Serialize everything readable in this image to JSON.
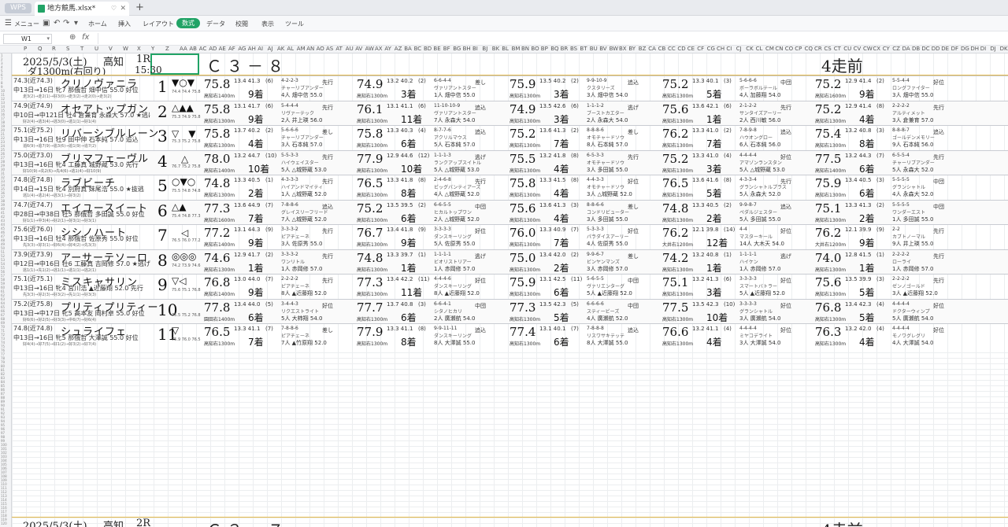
{
  "app": {
    "badge": "WPS",
    "file_tab": "地方競馬.xlsx*",
    "accent": "#21a366"
  },
  "menu": {
    "menu_label": "メニュー",
    "tabs": [
      "ホーム",
      "挿入",
      "レイアウト",
      "数式",
      "データ",
      "校閲",
      "表示",
      "ツール"
    ],
    "active_tab": "数式"
  },
  "formula": {
    "cell_ref": "W1",
    "fx": "fx",
    "content": ""
  },
  "columns": [
    "P",
    "Q",
    "R",
    "S",
    "T",
    "U",
    "V",
    "W",
    "X",
    "Y",
    "Z",
    "AA",
    "AB",
    "AC",
    "AD",
    "AE",
    "AF",
    "AG",
    "AH",
    "AI",
    "AJ",
    "AK",
    "AL",
    "AM",
    "AN",
    "AO",
    "AS",
    "AT",
    "AU",
    "AV",
    "AW",
    "AX",
    "AY",
    "AZ",
    "BA",
    "BC",
    "BD",
    "BE",
    "BF",
    "BG",
    "BH",
    "BI",
    "BJ",
    "BK",
    "BL",
    "BM",
    "BN",
    "BO",
    "BP",
    "BQ",
    "BR",
    "BS",
    "BT",
    "BU",
    "BV",
    "BW",
    "BX",
    "BY",
    "BZ",
    "CA",
    "CB",
    "CC",
    "CD",
    "CE",
    "CF",
    "CG",
    "CH",
    "CI",
    "CJ",
    "CK",
    "CL",
    "CM",
    "CN",
    "CO",
    "CP",
    "CQ",
    "CR",
    "CS",
    "CT",
    "CU",
    "CV",
    "CW",
    "CX",
    "CY",
    "CZ",
    "DA",
    "DB",
    "DC",
    "DD",
    "DE",
    "DF",
    "DG",
    "DH",
    "DI",
    "DJ",
    "DK",
    "DL",
    "DM",
    "DN"
  ],
  "race": {
    "date": "2025/5/3(土)",
    "venue": "高知",
    "race_no": "1R",
    "course": "ダ1300m(右回り)",
    "time": "15:30",
    "class": "Ｃ３－８",
    "prev_label": "4走前"
  },
  "horses": [
    {
      "rating": "74.3(近74.3)",
      "name": "クリノヴァニラ",
      "info": "中13日→16日 牝7 那俄哲 畑中信 55.0 好位",
      "trend": "走3(2)→走2(1)→好3(0)→走3(2)→走2(0)→走3(2)",
      "num": "1",
      "marks": "▼○▼",
      "idx": "74.4 74.4 75.8",
      "recs": [
        {
          "score": "75.8",
          "small": "13.4 41.3",
          "pos": "(6)",
          "course": "高知右1400m",
          "finish": "9着",
          "pass": "4-2-2-3",
          "horse": "チャーリブアンダー",
          "jockey": "4人 畑中信 55.0",
          "style": "先行"
        },
        {
          "score": "74.9",
          "small": "13.2 40.2",
          "pos": "(2)",
          "course": "高知右1300m",
          "finish": "3着",
          "pass": "6-6-4-4",
          "horse": "ヴァリアントスター",
          "jockey": "1人 畑中信 55.0",
          "style": "差し"
        },
        {
          "score": "75.9",
          "small": "13.5 40.2",
          "pos": "(2)",
          "course": "高知右1300m",
          "finish": "3着",
          "pass": "9-9-10-9",
          "horse": "クスタリーズ",
          "jockey": "3人 畑中信 54.0",
          "style": "追込"
        },
        {
          "score": "75.2",
          "small": "13.3 40.1",
          "pos": "(3)",
          "course": "高知右1300m",
          "finish": "5着",
          "pass": "5-6-6-6",
          "horse": "ボーラボルテール",
          "jockey": "4人 加藤翔 54.0",
          "style": "中団"
        },
        {
          "score": "75.2",
          "small": "12.9 41.4",
          "pos": "(2)",
          "course": "高知右1600m",
          "finish": "9着",
          "pass": "5-5-4-4",
          "horse": "ロングファイター",
          "jockey": "3人 畑中信 55.0",
          "style": "好位"
        }
      ]
    },
    {
      "rating": "74.9(近74.9)",
      "name": "オセアトップガン",
      "info": "中10日→中121日 牡4 倉兼育 永森大 57.0 ★逃げ",
      "trend": "好2(4)→逃3(4)→逃3(0)→逃1(1)→好1(4)",
      "num": "2",
      "marks": "△▲▲",
      "idx": "75.3 74.9 75.8",
      "recs": [
        {
          "score": "75.8",
          "small": "13.1 41.7",
          "pos": "(6)",
          "course": "高知右1300m",
          "finish": "9着",
          "pass": "5-4-4-4",
          "horse": "リヴァーテック",
          "jockey": "2人 井上瑛 56.0",
          "style": "先行"
        },
        {
          "score": "76.1",
          "small": "13.1 41.1",
          "pos": "(6)",
          "course": "高知右1300m",
          "finish": "11着",
          "pass": "11-10-10-9",
          "horse": "ヴァリアントスター",
          "jockey": "7人 永森大 54.0",
          "style": "追込"
        },
        {
          "score": "74.9",
          "small": "13.5 42.6",
          "pos": "(6)",
          "course": "高知右1300m",
          "finish": "3着",
          "pass": "1-1-1-2",
          "horse": "ブーストカエター",
          "jockey": "2人 永森大 54.0",
          "style": "逃げ"
        },
        {
          "score": "75.6",
          "small": "13.6 42.1",
          "pos": "(6)",
          "course": "高知右1300m",
          "finish": "1着",
          "pass": "2-1-2-2",
          "horse": "サンタイズアーリー",
          "jockey": "2人 西川敏 56.0",
          "style": "先行"
        },
        {
          "score": "75.2",
          "small": "12.9 41.4",
          "pos": "(8)",
          "course": "高知右1300m",
          "finish": "4着",
          "pass": "2-2-2-2",
          "horse": "アルティメット",
          "jockey": "3人 倉兼育 57.0",
          "style": "先行"
        }
      ]
    },
    {
      "rating": "75.1(近75.2)",
      "name": "リバーシブルレーン",
      "info": "中13日→16日 牡9 田中伸 石本純 57.0 追込",
      "trend": "追6(9)→追7(9)→追3(6)→追1(9)→追7(2)",
      "num": "3",
      "marks": "▽　▼",
      "idx": "75.3 75.2 75.8",
      "recs": [
        {
          "score": "75.8",
          "small": "13.7 40.2",
          "pos": "(2)",
          "course": "高知右1300m",
          "finish": "4着",
          "pass": "5-6-6-6",
          "horse": "チャーリブアンダー",
          "jockey": "3人 石本純 57.0",
          "style": "差し"
        },
        {
          "score": "75.8",
          "small": "13.3 40.3",
          "pos": "(4)",
          "course": "高知右1300m",
          "finish": "6着",
          "pass": "8-7-7-6",
          "horse": "アクリルマウス",
          "jockey": "5人 石本純 57.0",
          "style": "追込"
        },
        {
          "score": "75.2",
          "small": "13.6 41.3",
          "pos": "(2)",
          "course": "高知右1300m",
          "finish": "7着",
          "pass": "8-8-8-6",
          "horse": "オモチャードソウ",
          "jockey": "8人 石本純 57.0",
          "style": "差し"
        },
        {
          "score": "76.2",
          "small": "13.3 41.0",
          "pos": "(2)",
          "course": "高知右1300m",
          "finish": "7着",
          "pass": "7-8-9-8",
          "horse": "ハウオングロー",
          "jockey": "6人 石本純 56.0",
          "style": "追込"
        },
        {
          "score": "75.4",
          "small": "13.2 40.8",
          "pos": "(3)",
          "course": "高知右1300m",
          "finish": "8着",
          "pass": "8-8-8-7",
          "horse": "ゴールデンメモリー",
          "jockey": "9人 石本純 56.0",
          "style": "追込"
        }
      ]
    },
    {
      "rating": "75.0(近73.0)",
      "name": "ブリマフェーヴル",
      "info": "中13日→16日 牝4 工藤真 城野蔵 53.0 先行",
      "trend": "好10(9)→先2(6)→先4(6)→逃1(4)→好10(9)",
      "num": "4",
      "marks": "　△",
      "idx": "76.7 75.2 75.8",
      "recs": [
        {
          "score": "78.0",
          "small": "13.2 44.7",
          "pos": "(10)",
          "course": "高知右1400m",
          "finish": "10着",
          "pass": "5-5-3-3",
          "horse": "ハイウェイスター",
          "jockey": "5人 △城野蔵 53.0",
          "style": "先行"
        },
        {
          "score": "77.9",
          "small": "12.9 44.6",
          "pos": "(12)",
          "course": "高知右1300m",
          "finish": "10着",
          "pass": "1-1-1-3",
          "horse": "ランクアップスイトル",
          "jockey": "5人 △城野蔵 53.0",
          "style": "逃げ"
        },
        {
          "score": "75.5",
          "small": "13.2 41.8",
          "pos": "(8)",
          "course": "高知右1300m",
          "finish": "4着",
          "pass": "6-5-3-3",
          "horse": "オモチャードソウ",
          "jockey": "3人 多田誠 55.0",
          "style": "先行"
        },
        {
          "score": "75.2",
          "small": "13.3 41.0",
          "pos": "(4)",
          "course": "高知右1300m",
          "finish": "3着",
          "pass": "4-4-4-4",
          "horse": "アマゾンランスタン",
          "jockey": "5人 △城野蔵 53.0",
          "style": "好位"
        },
        {
          "score": "77.5",
          "small": "13.2 44.3",
          "pos": "(7)",
          "course": "高知右1400m",
          "finish": "6着",
          "pass": "6-5-5-4",
          "horse": "チャーリブアンダー",
          "jockey": "5人 永森大 52.0",
          "style": "先行"
        }
      ]
    },
    {
      "rating": "74.8(近74.8)",
      "name": "ラブビーチ",
      "info": "中14日→15日 牝4 別府真 妹尾浩 55.0 ★抜逃",
      "trend": "逃1(4)→逃2(4)→逃3(1)→好3(2)",
      "num": "5",
      "marks": "○▼○",
      "idx": "75.5 74.8 74.8",
      "recs": [
        {
          "score": "74.8",
          "small": "13.3 40.5",
          "pos": "(1)",
          "course": "高知右1300m",
          "finish": "2着",
          "pass": "4-3-3-3",
          "horse": "ハイアンドマイティ",
          "jockey": "1人 △城野蔵 52.0",
          "style": "先行"
        },
        {
          "score": "76.5",
          "small": "13.3 41.8",
          "pos": "(8)",
          "course": "高知右1300m",
          "finish": "8着",
          "pass": "2-4-6-8",
          "horse": "ビッグバンティアーズ",
          "jockey": "4人 △城野蔵 52.0",
          "style": "先行"
        },
        {
          "score": "75.8",
          "small": "13.3 41.5",
          "pos": "(8)",
          "course": "高知右1300m",
          "finish": "4着",
          "pass": "4-4-3-3",
          "horse": "オモチャードソウ",
          "jockey": "3人 △城野蔵 52.0",
          "style": "好位"
        },
        {
          "score": "76.5",
          "small": "13.6 41.6",
          "pos": "(8)",
          "course": "高知右1300m",
          "finish": "5着",
          "pass": "4-3-3-4",
          "horse": "グランシャトルプラス",
          "jockey": "5人 永森大 52.0",
          "style": "先行"
        },
        {
          "score": "75.9",
          "small": "13.4 40.5",
          "pos": "(3)",
          "course": "高知右1300m",
          "finish": "6着",
          "pass": "5-5-5-5",
          "horse": "グランシャトル",
          "jockey": "4人 永森大 52.0",
          "style": "中団"
        }
      ]
    },
    {
      "rating": "74.7(近74.7)",
      "name": "エイユースイート",
      "info": "中28日→中38日 牡5 那俄哲 多田誠 55.0 好位",
      "trend": "好1(1)→中3(4)→好2(1)→好3(1)→好3(1)",
      "num": "6",
      "marks": "△▲",
      "idx": "75.4 74.8 77.3",
      "recs": [
        {
          "score": "77.3",
          "small": "13.6 44.9",
          "pos": "(7)",
          "course": "高知右1600m",
          "finish": "7着",
          "pass": "7-8-8-6",
          "horse": "グレイスリーフリード",
          "jockey": "7人 △城野蔵 52.0",
          "style": "追込"
        },
        {
          "score": "75.2",
          "small": "13.5 39.5",
          "pos": "(2)",
          "course": "高知右1300m",
          "finish": "6着",
          "pass": "6-6-5-5",
          "horse": "ヒカルトップワン",
          "jockey": "2人 △城野蔵 52.0",
          "style": "中団"
        },
        {
          "score": "75.6",
          "small": "13.6 41.3",
          "pos": "(3)",
          "course": "高知右1300m",
          "finish": "4着",
          "pass": "8-8-6-6",
          "horse": "コンドリビューター",
          "jockey": "3人 多田誠 55.0",
          "style": "差し"
        },
        {
          "score": "74.8",
          "small": "13.3 40.5",
          "pos": "(2)",
          "course": "高知右1300m",
          "finish": "2着",
          "pass": "9-9-8-7",
          "horse": "ペダルジェスター",
          "jockey": "5人 多田誠 55.0",
          "style": "追込"
        },
        {
          "score": "75.1",
          "small": "13.3 41.3",
          "pos": "(2)",
          "course": "高知右1300m",
          "finish": "2着",
          "pass": "5-5-5-5",
          "horse": "ワンダーエスト",
          "jockey": "1人 多田誠 55.0",
          "style": "中団"
        }
      ]
    },
    {
      "rating": "75.6(近76.0)",
      "name": "シシノハート",
      "info": "中13日→16日 牡4 那俄哲 佐原秀 55.0 好位",
      "trend": "先3(3)→好3(1)→好6(4)→好4(2)→先3(3)",
      "num": "7",
      "marks": "　◁",
      "idx": "76.5 76.0 77.2",
      "recs": [
        {
          "score": "77.2",
          "small": "13.1 44.3",
          "pos": "(9)",
          "course": "高知右1400m",
          "finish": "9着",
          "pass": "3-3-3-2",
          "horse": "ピアチェーネ",
          "jockey": "3人 佐原秀 55.0",
          "style": "先行"
        },
        {
          "score": "76.7",
          "small": "13.4 41.8",
          "pos": "(9)",
          "course": "高知右1300m",
          "finish": "9着",
          "pass": "3-3-3-3",
          "horse": "ダンスキーリング",
          "jockey": "5人 佐原秀 55.0",
          "style": "好位"
        },
        {
          "score": "76.0",
          "small": "13.3 40.9",
          "pos": "(7)",
          "course": "高知右1300m",
          "finish": "7着",
          "pass": "5-3-3-3",
          "horse": "パラダイスアーリー",
          "jockey": "4人 佐原秀 55.0",
          "style": "好位"
        },
        {
          "score": "76.2",
          "small": "12.1 39.8",
          "pos": "(14)",
          "course": "大井右1200m",
          "finish": "12着",
          "pass": "4-4",
          "horse": "マスターキール",
          "jockey": "14人 大木天 54.0",
          "style": "好位"
        },
        {
          "score": "76.2",
          "small": "12.1 39.9",
          "pos": "(9)",
          "course": "大井右1200m",
          "finish": "9着",
          "pass": "2-2",
          "horse": "カブトノーマル",
          "jockey": "9人 井上瑛 55.0",
          "style": "先行"
        }
      ]
    },
    {
      "rating": "73.9(近73.9)",
      "name": "アーサーテソーロ",
      "info": "中12日→中16日 牡6 工藤真 吉岡修 57.0 ★逃げ",
      "trend": "逃1(1)→先1(2)→逃1(1)→逃1(1)→逃2(1)",
      "num": "8",
      "marks": "◎◎◎",
      "idx": "74.2 73.9 74.6",
      "recs": [
        {
          "score": "74.6",
          "small": "12.9 41.7",
          "pos": "(2)",
          "course": "高知右1300m",
          "finish": "1着",
          "pass": "3-3-3-2",
          "horse": "ワンリトル",
          "jockey": "1人 赤岡修 57.0",
          "style": "先行"
        },
        {
          "score": "74.8",
          "small": "13.3 39.7",
          "pos": "(1)",
          "course": "高知右1300m",
          "finish": "1着",
          "pass": "1-1-1-1",
          "horse": "ビオリストリアー",
          "jockey": "1人 赤岡修 57.0",
          "style": "逃げ"
        },
        {
          "score": "75.0",
          "small": "13.4 42.0",
          "pos": "(2)",
          "course": "高知右1300m",
          "finish": "2着",
          "pass": "9-9-6-7",
          "horse": "ビンヤンマンズ",
          "jockey": "3人 赤岡修 57.0",
          "style": "差し"
        },
        {
          "score": "74.2",
          "small": "13.2 40.8",
          "pos": "(1)",
          "course": "高知右1300m",
          "finish": "1着",
          "pass": "1-1-1-1",
          "horse": "ハイケン",
          "jockey": "1人 赤岡修 57.0",
          "style": "逃げ"
        },
        {
          "score": "74.0",
          "small": "12.8 41.5",
          "pos": "(1)",
          "course": "高知右1300m",
          "finish": "1着",
          "pass": "2-2-2-2",
          "horse": "ローライ",
          "jockey": "1人 赤岡修 57.0",
          "style": "先行"
        }
      ]
    },
    {
      "rating": "75.1(近75.1)",
      "name": "ミスキャサリン",
      "info": "中13日→16日 牝4 宮川浩 ▲近藤翔 52.0 先行",
      "trend": "先3(3)→好2(3)→好3(2)→先1(1)→好3(3)",
      "num": "9",
      "marks": "▽◁",
      "idx": "75.6 75.1 76.8",
      "recs": [
        {
          "score": "76.8",
          "small": "13.0 44.0",
          "pos": "(7)",
          "course": "高知右1400m",
          "finish": "9着",
          "pass": "2-2-2-2",
          "horse": "ピアチェーネ",
          "jockey": "8人 ▲近藤翔 52.0",
          "style": "先行"
        },
        {
          "score": "77.3",
          "small": "13.4 42.2",
          "pos": "(11)",
          "course": "高知右1300m",
          "finish": "11着",
          "pass": "4-4-4-6",
          "horse": "ダンスキーリング",
          "jockey": "8人 ▲近藤翔 52.0",
          "style": "好位"
        },
        {
          "score": "75.9",
          "small": "13.1 42.5",
          "pos": "(11)",
          "course": "高知右1300m",
          "finish": "6着",
          "pass": "5-6-5-5",
          "horse": "ヴァリエンターグ",
          "jockey": "5人 ▲近藤翔 52.0",
          "style": "中団"
        },
        {
          "score": "75.1",
          "small": "13.2 41.3",
          "pos": "(6)",
          "course": "高知右1300m",
          "finish": "3着",
          "pass": "3-3-3-3",
          "horse": "スマートバトラー",
          "jockey": "5人 ▲近藤翔 52.0",
          "style": "好位"
        },
        {
          "score": "75.6",
          "small": "13.5 39.9",
          "pos": "(3)",
          "course": "高知右1300m",
          "finish": "5着",
          "pass": "2-2-2-2",
          "horse": "ゼンノゴールド",
          "jockey": "3人 ▲近藤翔 52.0",
          "style": "先行"
        }
      ]
    },
    {
      "rating": "75.2(近75.8)",
      "name": "プリティプリティー",
      "info": "中13日→中17日 牝5 高本友 岡村卓 55.0 好位",
      "trend": "好6(6)→好2(5)→好3(3)→中6(7)→好6(4)",
      "num": "10",
      "marks": "",
      "idx": "75.5 75.2 76.8",
      "recs": [
        {
          "score": "77.8",
          "small": "13.4 44.0",
          "pos": "(5)",
          "course": "園田右1400m",
          "finish": "6着",
          "pass": "3-4-4-3",
          "horse": "リクエストライト",
          "jockey": "5人 大柿翔 54.0",
          "style": "好位"
        },
        {
          "score": "77.7",
          "small": "13.7 40.8",
          "pos": "(3)",
          "course": "高知右1300m",
          "finish": "6着",
          "pass": "6-6-4-1",
          "horse": "シタノヒカリ",
          "jockey": "2人 廣瀬航 54.0",
          "style": "中団"
        },
        {
          "score": "77.3",
          "small": "13.5 42.3",
          "pos": "(5)",
          "course": "高知右1300m",
          "finish": "5着",
          "pass": "6-6-6-6",
          "horse": "スティービーズ",
          "jockey": "4人 廣瀬航 52.0",
          "style": "中団"
        },
        {
          "score": "77.5",
          "small": "13.5 42.3",
          "pos": "(10)",
          "course": "高知右1300m",
          "finish": "10着",
          "pass": "3-3-3-3",
          "horse": "グランシャトル",
          "jockey": "3人 廣瀬航 54.0",
          "style": "好位"
        },
        {
          "score": "76.8",
          "small": "13.4 42.3",
          "pos": "(4)",
          "course": "高知右1300m",
          "finish": "5着",
          "pass": "4-4-4-4",
          "horse": "ドクターウィンプ",
          "jockey": "5人 廣瀬航 54.0",
          "style": "好位"
        }
      ]
    },
    {
      "rating": "74.8(近74.8)",
      "name": "シュライフェ",
      "info": "中13日→16日 牝5 那俄哲 大澤誠 55.0 好位",
      "trend": "好4(4)→好7(5)→好1(2)→好3(2)→好7(4)",
      "num": "11",
      "marks": "▽",
      "idx": "75.9 76.0 76.5",
      "recs": [
        {
          "score": "76.5",
          "small": "13.3 41.1",
          "pos": "(7)",
          "course": "高知右1300m",
          "finish": "7着",
          "pass": "7-8-8-6",
          "horse": "ピアチェーネ",
          "jockey": "7人 ▲竹原翔 52.0",
          "style": "差し"
        },
        {
          "score": "77.9",
          "small": "13.3 41.1",
          "pos": "(8)",
          "course": "高知右1300m",
          "finish": "8着",
          "pass": "9-9-11-11",
          "horse": "ダンスキーリング",
          "jockey": "8人 大澤誠 55.0",
          "style": "追込"
        },
        {
          "score": "77.4",
          "small": "13.1 40.1",
          "pos": "(7)",
          "course": "高知右1300m",
          "finish": "6着",
          "pass": "7-8-8-8",
          "horse": "リスワサキテッテ",
          "jockey": "8人 大澤誠 55.0",
          "style": "追込"
        },
        {
          "score": "76.6",
          "small": "13.2 41.1",
          "pos": "(4)",
          "course": "高知右1300m",
          "finish": "4着",
          "pass": "4-4-4-4",
          "horse": "ミヤコデライト",
          "jockey": "3人 大澤誠 54.0",
          "style": "好位"
        },
        {
          "score": "76.3",
          "small": "13.2 42.0",
          "pos": "(4)",
          "course": "高知右1300m",
          "finish": "4着",
          "pass": "4-4-4-4",
          "horse": "モノワグレグリ",
          "jockey": "4人 大澤誠 54.0",
          "style": "好位"
        }
      ]
    }
  ],
  "next_race": {
    "date": "2025/5/3(土)",
    "venue": "高知",
    "race_no": "2R",
    "class": "Ｃ３－７",
    "prev_label": "4走前"
  }
}
